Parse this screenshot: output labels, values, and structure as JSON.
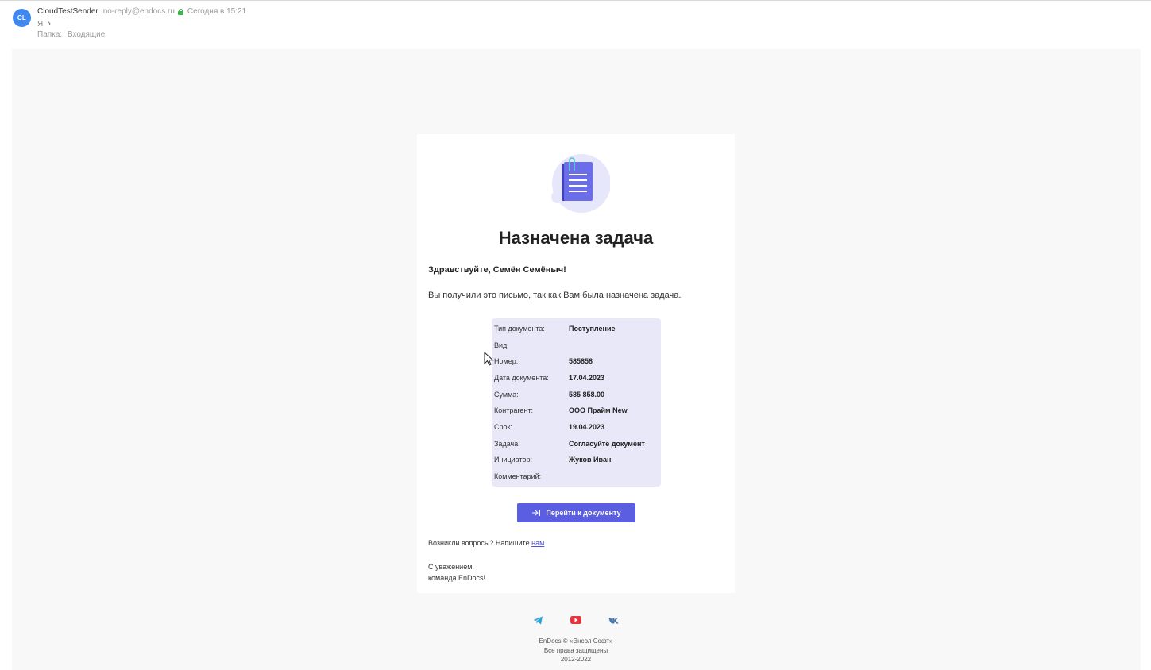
{
  "header": {
    "avatar_initials": "CL",
    "sender_name": "CloudTestSender",
    "sender_email": "no-reply@endocs.ru",
    "date": "Сегодня в 15:21",
    "recipient": "Я",
    "folder_label": "Папка:",
    "folder_value": "Входящие"
  },
  "email": {
    "title": "Назначена задача",
    "greeting": "Здравствуйте, Семён Семёныч!",
    "intro": "Вы получили это письмо, так как Вам была назначена задача.",
    "details": [
      {
        "label": "Тип документа:",
        "value": "Поступление"
      },
      {
        "label": "Вид:",
        "value": ""
      },
      {
        "label": "Номер:",
        "value": "585858"
      },
      {
        "label": "Дата документа:",
        "value": "17.04.2023"
      },
      {
        "label": "Сумма:",
        "value": "585 858.00"
      },
      {
        "label": "Контрагент:",
        "value": "ООО Прайм New"
      },
      {
        "label": "Срок:",
        "value": "19.04.2023"
      },
      {
        "label": "Задача:",
        "value": "Согласуйте документ"
      },
      {
        "label": "Инициатор:",
        "value": "Жуков Иван"
      },
      {
        "label": "Комментарий:",
        "value": ""
      }
    ],
    "button_label": "Перейти к документу",
    "questions_text": "Возникли вопросы? Напишите",
    "questions_link": "нам",
    "regards_line1": "С уважением,",
    "regards_line2": "команда EnDocs!"
  },
  "footer": {
    "social_icons": [
      "telegram-icon",
      "youtube-icon",
      "vk-icon"
    ],
    "line1": "EnDocs © «Энсол Софт»",
    "line2": "Все права защищены",
    "line3": "2012-2022"
  },
  "colors": {
    "accent": "#5b5ee0",
    "avatar": "#3f88f2",
    "info_box": "#e8e8f9"
  }
}
